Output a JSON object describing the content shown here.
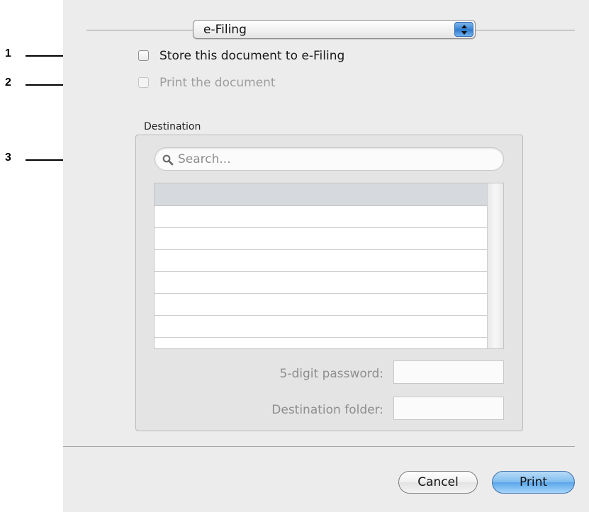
{
  "callouts": [
    "1",
    "2",
    "3"
  ],
  "popup": {
    "value": "e-Filing",
    "icon": "up-down-stepper-icon"
  },
  "options": {
    "store_label": "Store this document to e-Filing",
    "store_checked": false,
    "print_label": "Print the document",
    "print_checked": false,
    "print_enabled": false
  },
  "destination": {
    "title": "Destination",
    "search_placeholder": "Search...",
    "list_rows": [
      "",
      "",
      "",
      "",
      "",
      "",
      ""
    ],
    "password_label": "5-digit password:",
    "password_value": "",
    "folder_label": "Destination folder:",
    "folder_value": ""
  },
  "buttons": {
    "cancel": "Cancel",
    "print": "Print"
  },
  "colors": {
    "default_button": "#7ebcf0",
    "dialog_bg": "#ececec",
    "disabled_text": "#9e9e9e"
  }
}
